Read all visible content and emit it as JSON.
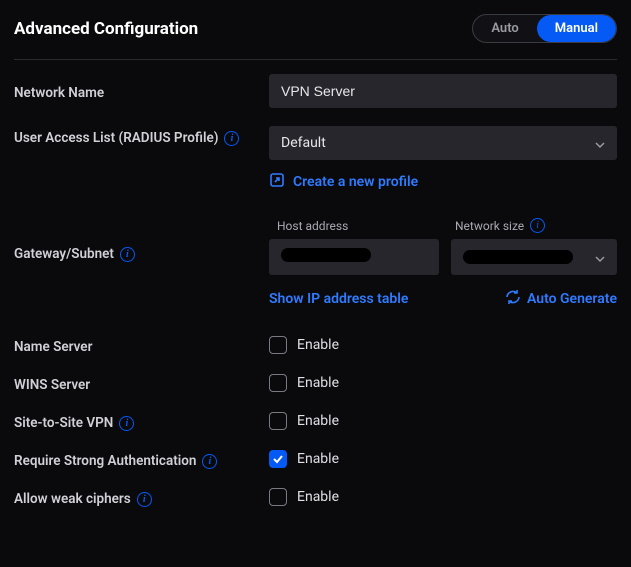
{
  "title": "Advanced Configuration",
  "mode": {
    "auto": "Auto",
    "manual": "Manual"
  },
  "labels": {
    "network_name": "Network Name",
    "user_access": "User Access List (RADIUS Profile)",
    "gateway": "Gateway/Subnet",
    "name_server": "Name Server",
    "wins_server": "WINS Server",
    "site_to_site": "Site-to-Site VPN",
    "strong_auth": "Require Strong Authentication",
    "weak_ciphers": "Allow weak ciphers"
  },
  "fields": {
    "network_name_value": "VPN Server",
    "user_access_value": "Default",
    "host_label": "Host address",
    "network_size_label": "Network size"
  },
  "links": {
    "create_profile": "Create a new profile",
    "show_ip_table": "Show IP address table",
    "auto_generate": "Auto Generate"
  },
  "enable_label": "Enable"
}
